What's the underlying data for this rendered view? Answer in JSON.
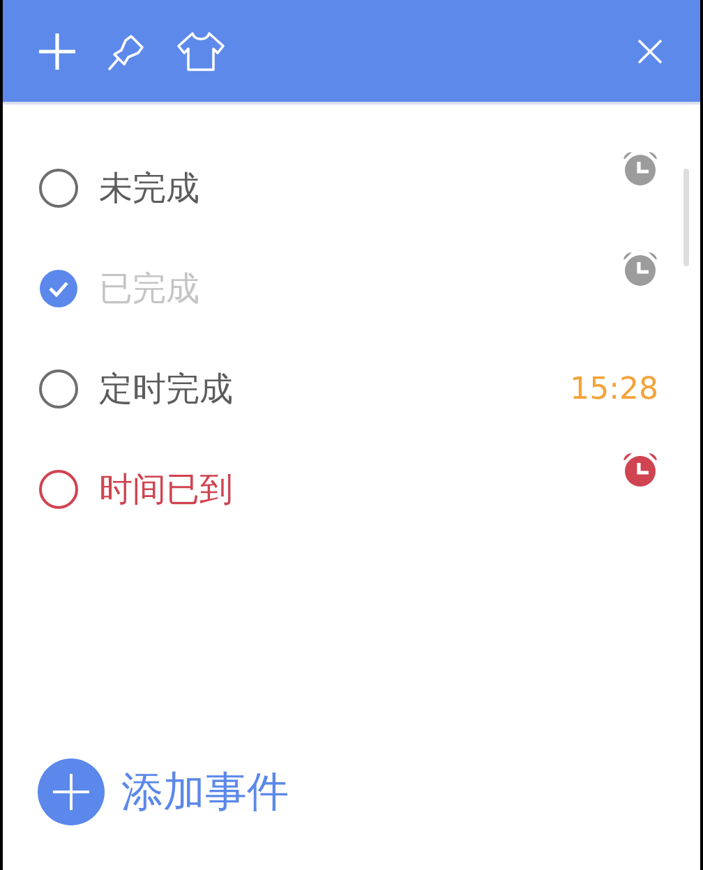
{
  "toolbar": {
    "buttons": [
      {
        "kind": "add"
      },
      {
        "kind": "pin"
      },
      {
        "kind": "skin"
      },
      {
        "kind": "close"
      }
    ]
  },
  "tasks": [
    {
      "title": "未完成",
      "checked": false,
      "overdue": false,
      "trailing": {
        "kind": "alarm"
      }
    },
    {
      "title": "已完成",
      "checked": true,
      "overdue": false,
      "trailing": {
        "kind": "alarm"
      }
    },
    {
      "title": "定时完成",
      "checked": false,
      "overdue": false,
      "trailing": {
        "kind": "time",
        "text": "15:28"
      }
    },
    {
      "title": "时间已到",
      "checked": false,
      "overdue": true,
      "trailing": {
        "kind": "alarm"
      }
    }
  ],
  "add_button": {
    "label": "添加事件"
  }
}
